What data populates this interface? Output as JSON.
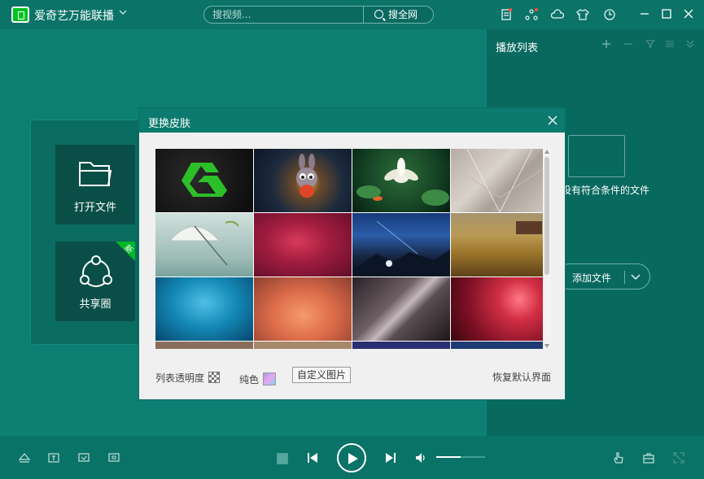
{
  "app": {
    "title": "爱奇艺万能联播",
    "title_menu_icon": "chevron-down-icon",
    "accent_color": "#00c21f"
  },
  "search": {
    "placeholder": "搜视频...",
    "button_label": "搜全网"
  },
  "titlebar_icons": [
    "doc-icon",
    "share-icon",
    "cloud-icon",
    "tshirt-icon",
    "clock-icon",
    "minimize-icon",
    "maximize-icon",
    "close-icon"
  ],
  "playlist": {
    "title": "播放列表",
    "empty_text": "没有符合条件的文件",
    "add_file_label": "添加文件",
    "header_icons": [
      "plus-icon",
      "minus-icon",
      "filter-icon",
      "list-icon",
      "collapse-icon"
    ]
  },
  "left_panel": {
    "open_file_label": "打开文件",
    "share_label": "共享圈",
    "new_badge": "新"
  },
  "dialog": {
    "title": "更换皮肤",
    "opacity_label": "列表透明度",
    "solid_label": "纯色",
    "custom_label": "自定义图片",
    "restore_label": "恢复默认界面",
    "skins": [
      {
        "name": "iqiyi-logo-skin"
      },
      {
        "name": "rabbit-skin"
      },
      {
        "name": "lotus-skin"
      },
      {
        "name": "gray-geometric-skin"
      },
      {
        "name": "umbrella-skin"
      },
      {
        "name": "crimson-skin"
      },
      {
        "name": "starry-night-skin"
      },
      {
        "name": "wheat-field-skin"
      },
      {
        "name": "water-drop-skin"
      },
      {
        "name": "peach-petals-skin"
      },
      {
        "name": "leaf-macro-skin"
      },
      {
        "name": "red-bokeh-skin"
      }
    ]
  },
  "player": {
    "volume_level": 0.5,
    "left_icons": [
      "eject-icon",
      "subtitle-icon",
      "screenshot-icon",
      "capture-icon"
    ],
    "right_icons": [
      "touch-icon",
      "toolbox-icon",
      "fullscreen-icon"
    ]
  }
}
